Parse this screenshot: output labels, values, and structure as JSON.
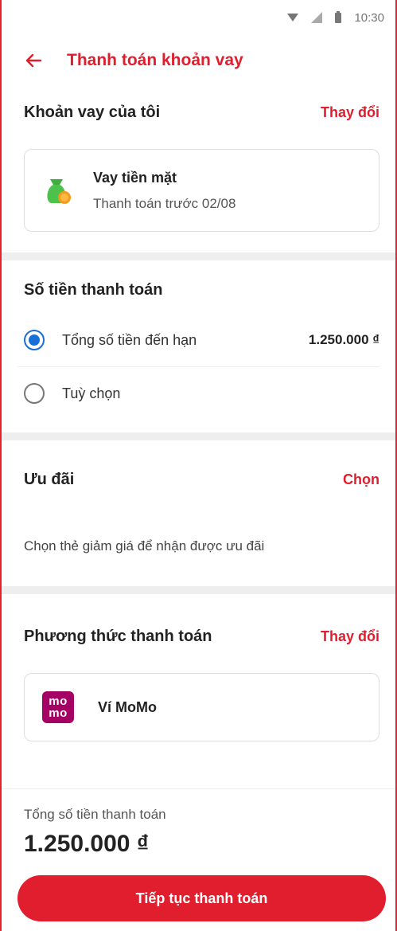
{
  "status_bar": {
    "time": "10:30"
  },
  "header": {
    "title": "Thanh toán khoản vay",
    "back_icon": "arrow-left-icon"
  },
  "my_loan": {
    "title": "Khoản vay của tôi",
    "change_label": "Thay đổi",
    "loan": {
      "name": "Vay tiền mặt",
      "due": "Thanh toán trước 02/08",
      "icon": "money-bag-icon"
    }
  },
  "payment_amount": {
    "title": "Số tiền thanh toán",
    "options": [
      {
        "label": "Tổng số tiền đến hạn",
        "value": "1.250.000 ₫",
        "selected": true
      },
      {
        "label": "Tuỳ chọn",
        "value": "",
        "selected": false
      }
    ]
  },
  "promotion": {
    "title": "Ưu đãi",
    "choose_label": "Chọn",
    "description": "Chọn thẻ giảm giá để nhận được ưu đãi"
  },
  "payment_method": {
    "title": "Phương thức thanh toán",
    "change_label": "Thay đổi",
    "method": {
      "name": "Ví MoMo",
      "logo_top": "mo",
      "logo_bottom": "mo",
      "logo_color": "#a50064"
    }
  },
  "footer": {
    "total_label": "Tổng số tiền thanh toán",
    "total_value": "1.250.000 ₫",
    "cta_label": "Tiếp tục thanh toán"
  },
  "colors": {
    "accent": "#e01e2d",
    "radio_selected": "#1a6fd6",
    "divider": "#eeeeee"
  }
}
